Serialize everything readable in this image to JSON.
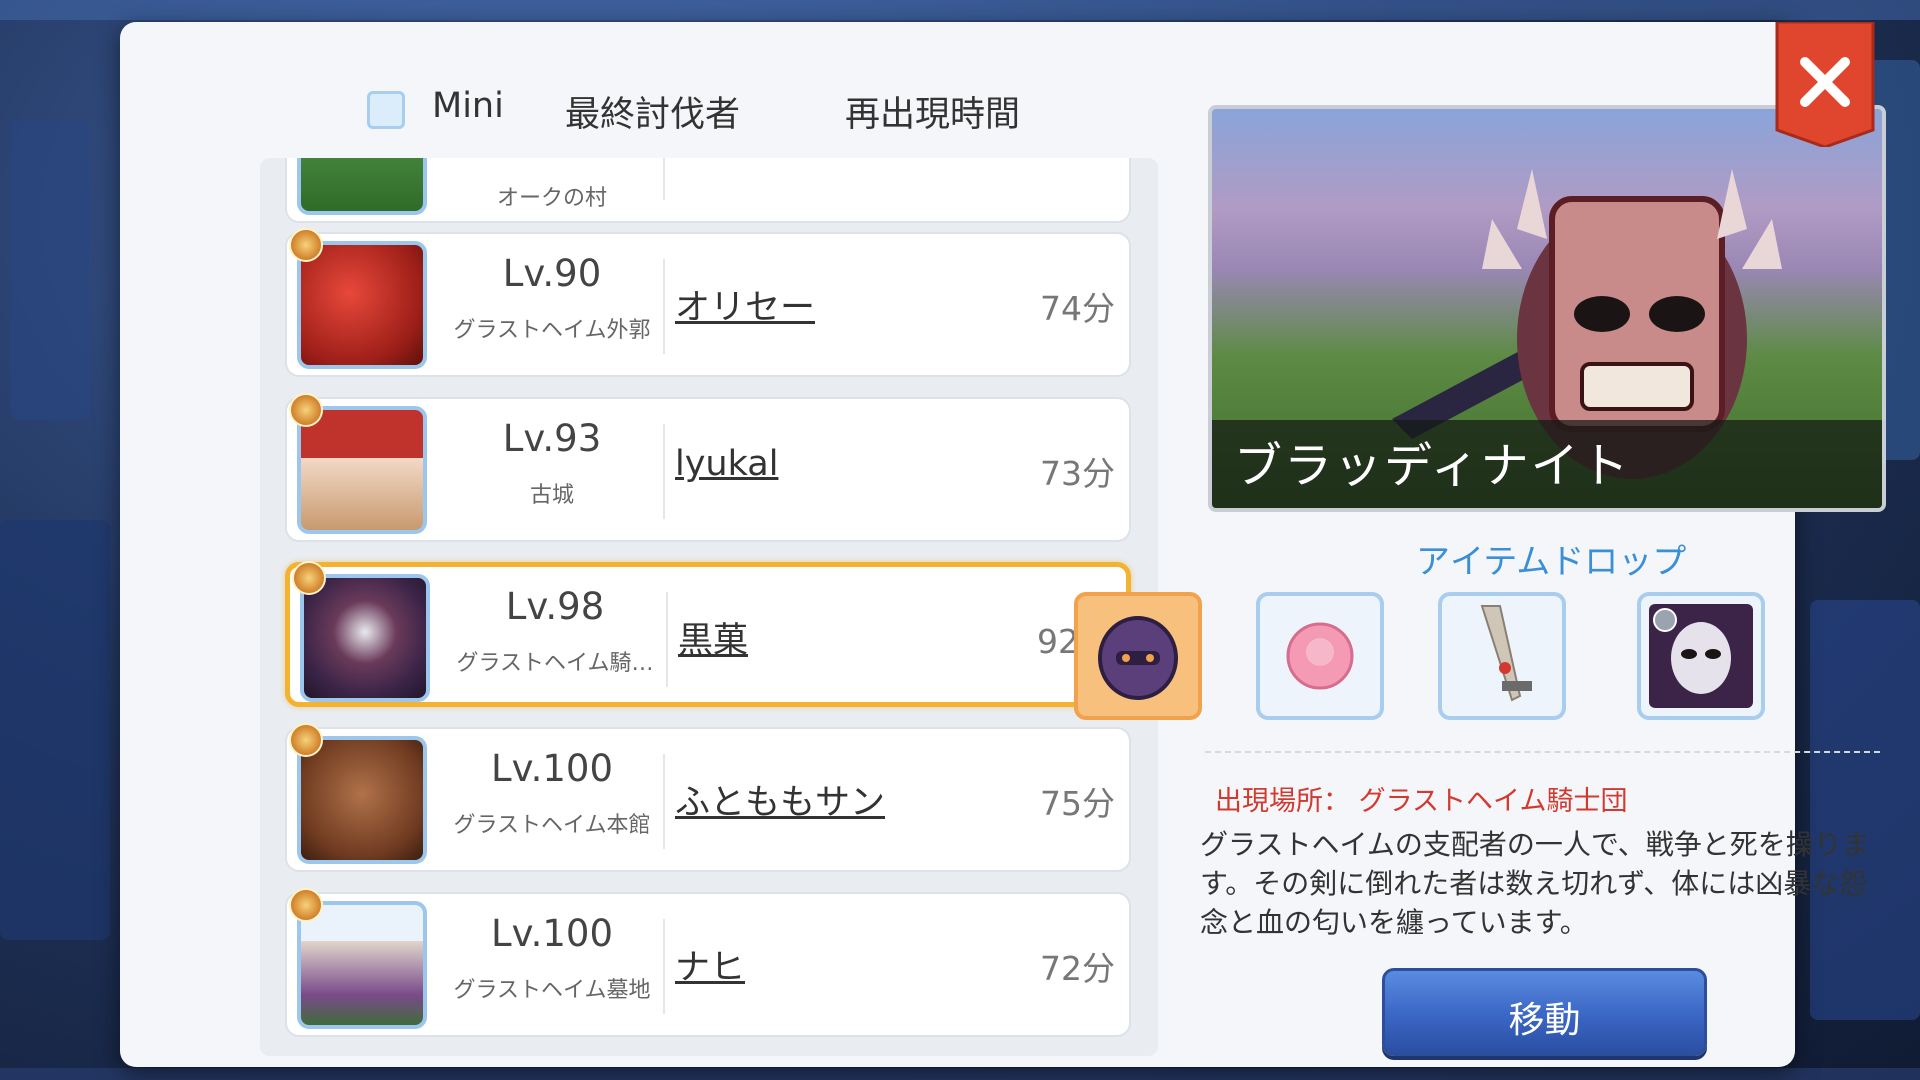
{
  "header": {
    "mini_label": "Mini",
    "killer_label": "最終討伐者",
    "respawn_label": "再出現時間"
  },
  "list": {
    "partial_row_map": "オークの村",
    "rows": [
      {
        "level": "Lv.90",
        "map": "グラストヘイム外郭",
        "killer": "オリセー",
        "time": "74分",
        "icon": "red-dragon-portrait"
      },
      {
        "level": "Lv.93",
        "map": "古城",
        "killer": "lyukal",
        "time": "73分",
        "icon": "top-hat-cat-portrait"
      },
      {
        "level": "Lv.98",
        "map": "グラストヘイム騎…",
        "killer": "黒菓",
        "time": "92分",
        "icon": "bloody-knight-portrait",
        "selected": true
      },
      {
        "level": "Lv.100",
        "map": "グラストヘイム本館",
        "killer": "ふとももサン",
        "time": "75分",
        "icon": "horned-demon-portrait"
      },
      {
        "level": "Lv.100",
        "map": "グラストヘイム墓地",
        "killer": "ナヒ",
        "time": "72分",
        "icon": "skeleton-lord-portrait"
      }
    ]
  },
  "detail": {
    "boss_name": "ブラッディナイト",
    "drop_title": "アイテムドロップ",
    "drops": [
      {
        "icon": "helm-card-icon",
        "highlight": true
      },
      {
        "icon": "pink-rose-icon"
      },
      {
        "icon": "drill-spear-icon"
      },
      {
        "icon": "bloody-knight-card-icon"
      }
    ],
    "location": "出現場所： グラストヘイム騎士団",
    "description": "グラストヘイムの支配者の一人で、戦争と死を操ります。その剣に倒れた者は数え切れず、体には凶暴な怨念と血の匂いを纏っています。",
    "move_label": "移動"
  },
  "colors": {
    "accent_blue": "#3a8fd6",
    "selected_border": "#f4b233",
    "location_red": "#d23a30",
    "close_red": "#e0452d"
  }
}
